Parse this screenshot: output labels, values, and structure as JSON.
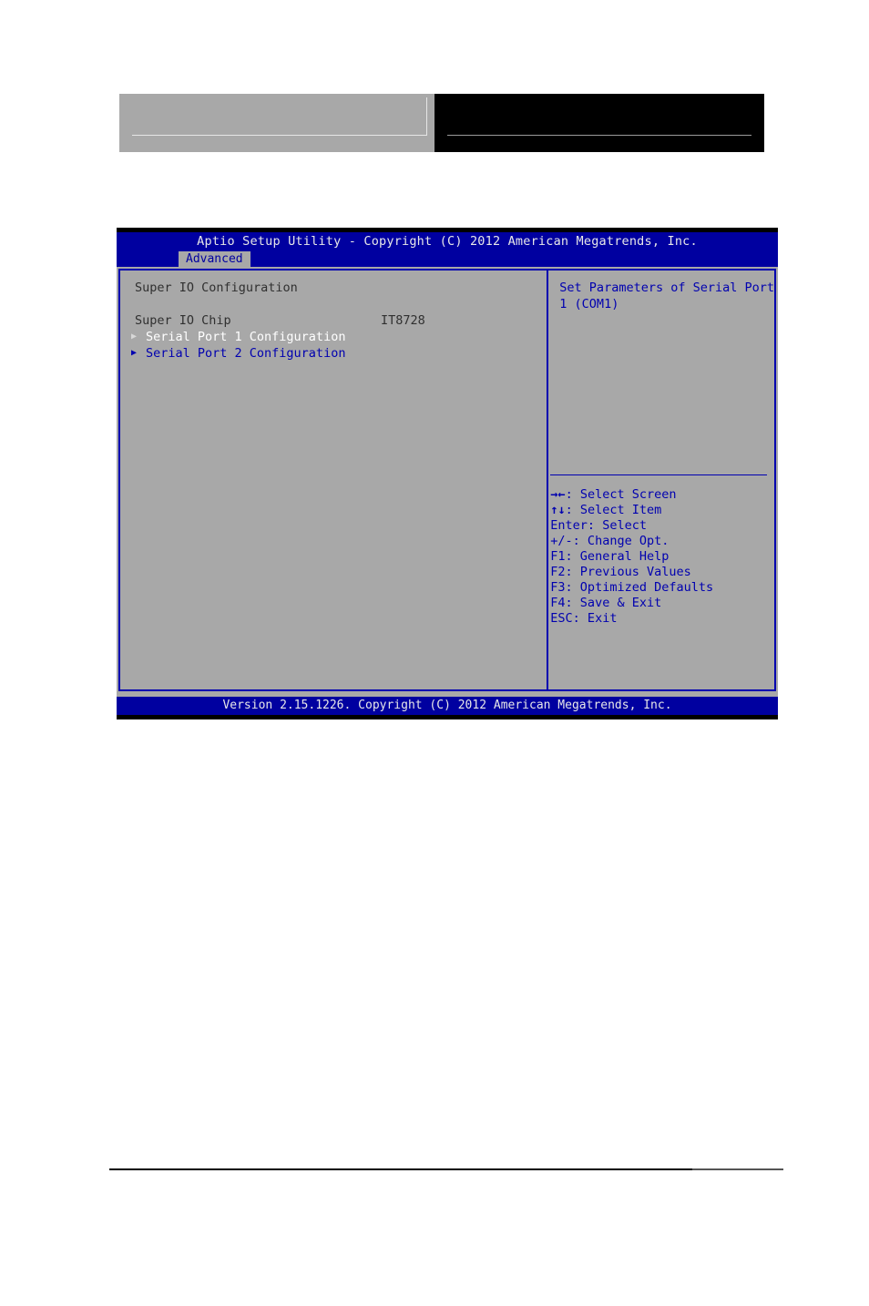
{
  "bios": {
    "title": "Aptio Setup Utility - Copyright (C) 2012 American Megatrends, Inc.",
    "tab": "Advanced",
    "footer": "Version 2.15.1226. Copyright (C) 2012 American Megatrends, Inc.",
    "section_title": "Super IO Configuration",
    "caret": "▶",
    "items": [
      {
        "label": "Super IO Chip",
        "value": "IT8728"
      },
      {
        "label": "Serial Port 1 Configuration"
      },
      {
        "label": "Serial Port 2 Configuration"
      }
    ],
    "help": [
      "Set Parameters of Serial Port",
      "1 (COM1)"
    ],
    "nav_keys": [
      {
        "glyph": "→←",
        "text": ": Select Screen"
      },
      {
        "glyph": "↑↓",
        "text": ": Select Item"
      },
      {
        "glyph": "",
        "text": "Enter: Select"
      },
      {
        "glyph": "",
        "text": "+/-: Change Opt."
      },
      {
        "glyph": "",
        "text": "F1: General Help"
      },
      {
        "glyph": "",
        "text": "F2: Previous Values"
      },
      {
        "glyph": "",
        "text": "F3: Optimized Defaults"
      },
      {
        "glyph": "",
        "text": "F4: Save & Exit"
      },
      {
        "glyph": "",
        "text": "ESC: Exit"
      }
    ]
  },
  "colors": {
    "title_bar": "#0000a0",
    "panel_bg": "#a8a8a8",
    "border": "#0000b0",
    "text_blue": "#0000b0",
    "text_dark": "#303030",
    "selected": "#ffffff"
  }
}
